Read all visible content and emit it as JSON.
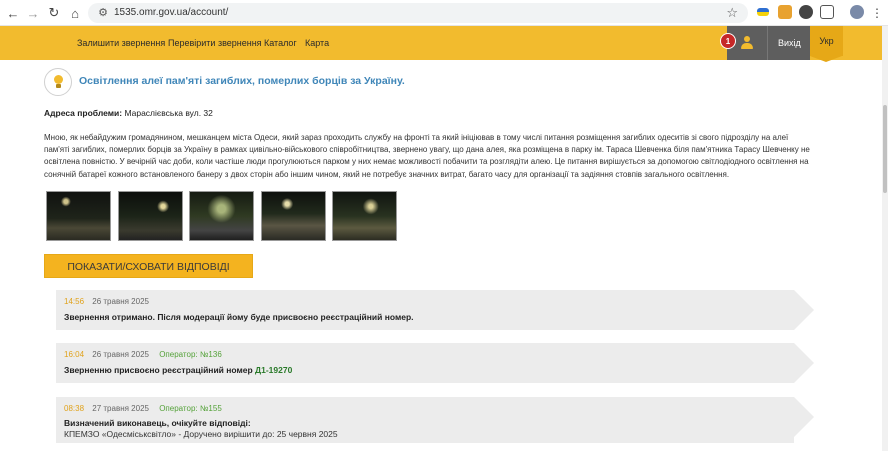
{
  "browser": {
    "url": "1535.omr.gov.ua/account/"
  },
  "header": {
    "nav": [
      {
        "label": "Залишити звернення"
      },
      {
        "label": "Перевірити звернення"
      },
      {
        "label": "Каталог"
      },
      {
        "label": "Карта"
      }
    ],
    "notification_count": "1",
    "logout_label": "Вихід",
    "language_label": "Укр"
  },
  "appeal": {
    "title": "Освітлення алеї пам'яті загиблих, померлих борців за Україну.",
    "address_label": "Адреса проблеми:",
    "address_value": "Мараслієвська вул. 32",
    "description": "Мною, як небайдужим громадянином, мешканцем міста Одеси, який зараз проходить службу на фронті та який ініціював в тому числі питання розміщення загиблих одеситів зі свого підрозділу на алеї пам'яті загиблих, померлих борців за Україну в рамках цивільно-військового співробітництва, звернено увагу, що дана алея, яка розміщена в парку ім. Тараса Шевченка біля пам'ятника Тарасу Шевченку не освітлена повністю. У вечірній час доби, коли частіше люди прогулюються парком у них немає можливості побачити та розглядіти алею. Це питання вирішується за допомогою світлодіодного освітлення на сонячній батареї кожного встановленого банеру з двох сторін або іншим чином, який не потребує значних витрат, багато часу для організації та задіяння стовпів загального освітлення.",
    "toggle_label": "ПОКАЗАТИ/СХОВАТИ ВІДПОВІДІ"
  },
  "timeline": [
    {
      "time": "14:56",
      "date": "26 травня 2025",
      "operator": "",
      "text": "Звернення отримано. Після модерації йому буде присвоєно реєстраційний номер.",
      "reg_number": "",
      "sub": ""
    },
    {
      "time": "16:04",
      "date": "26 травня 2025",
      "operator": "Оператор: №136",
      "text": "Зверненню присвоєно реєстраційний номер ",
      "reg_number": "Д1-19270",
      "sub": ""
    },
    {
      "time": "08:38",
      "date": "27 травня 2025",
      "operator": "Оператор: №155",
      "text": "Визначений виконавець, очікуйте відповіді:",
      "reg_number": "",
      "sub": "КПЕМЗО «Одесміськсвітло» - Доручено вирішити до: 25 червня 2025"
    }
  ],
  "colors": {
    "header_bg": "#f2bb2e",
    "title_blue": "#3f86b8",
    "time_orange": "#e0a21b",
    "operator_green": "#55a23a",
    "badge_red": "#c62828"
  }
}
